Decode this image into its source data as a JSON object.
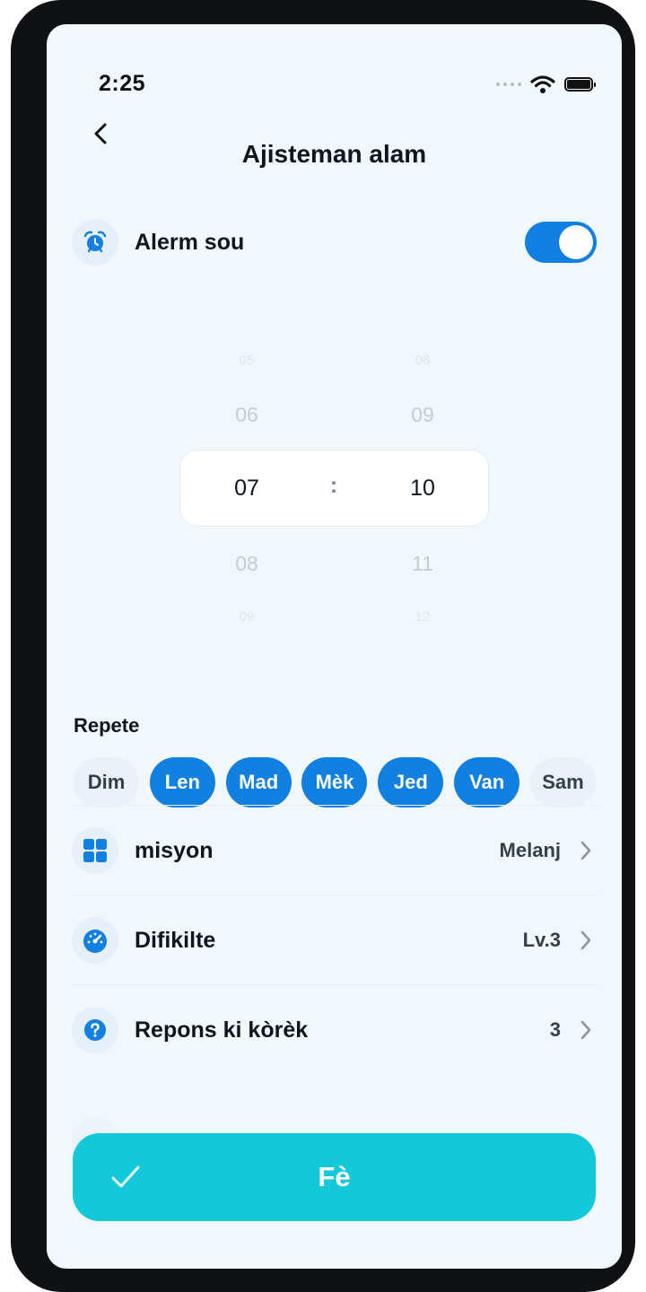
{
  "status_bar": {
    "time": "2:25"
  },
  "header": {
    "title": "Ajisteman alam"
  },
  "alarm": {
    "label": "Alerm sou",
    "enabled": true
  },
  "time_picker": {
    "hours": {
      "far_above": "05",
      "above": "06",
      "selected": "07",
      "below": "08",
      "far_below": "09"
    },
    "separator": ":",
    "minutes": {
      "far_above": "08",
      "above": "09",
      "selected": "10",
      "below": "11",
      "far_below": "12"
    }
  },
  "repeat": {
    "label": "Repete",
    "days": [
      {
        "label": "Dim",
        "selected": false
      },
      {
        "label": "Len",
        "selected": true
      },
      {
        "label": "Mad",
        "selected": true
      },
      {
        "label": "Mèk",
        "selected": true
      },
      {
        "label": "Jed",
        "selected": true
      },
      {
        "label": "Van",
        "selected": true
      },
      {
        "label": "Sam",
        "selected": false
      }
    ]
  },
  "settings": [
    {
      "label": "misyon",
      "value": "Melanj",
      "icon": "grid-icon"
    },
    {
      "label": "Difikilte",
      "value": "Lv.3",
      "icon": "speedometer-icon"
    },
    {
      "label": "Repons ki kòrèk",
      "value": "3",
      "icon": "question-icon"
    }
  ],
  "done_button": {
    "label": "Fè"
  },
  "colors": {
    "accent": "#1280e0",
    "done": "#13c8d8",
    "background": "#f2f7fc"
  }
}
